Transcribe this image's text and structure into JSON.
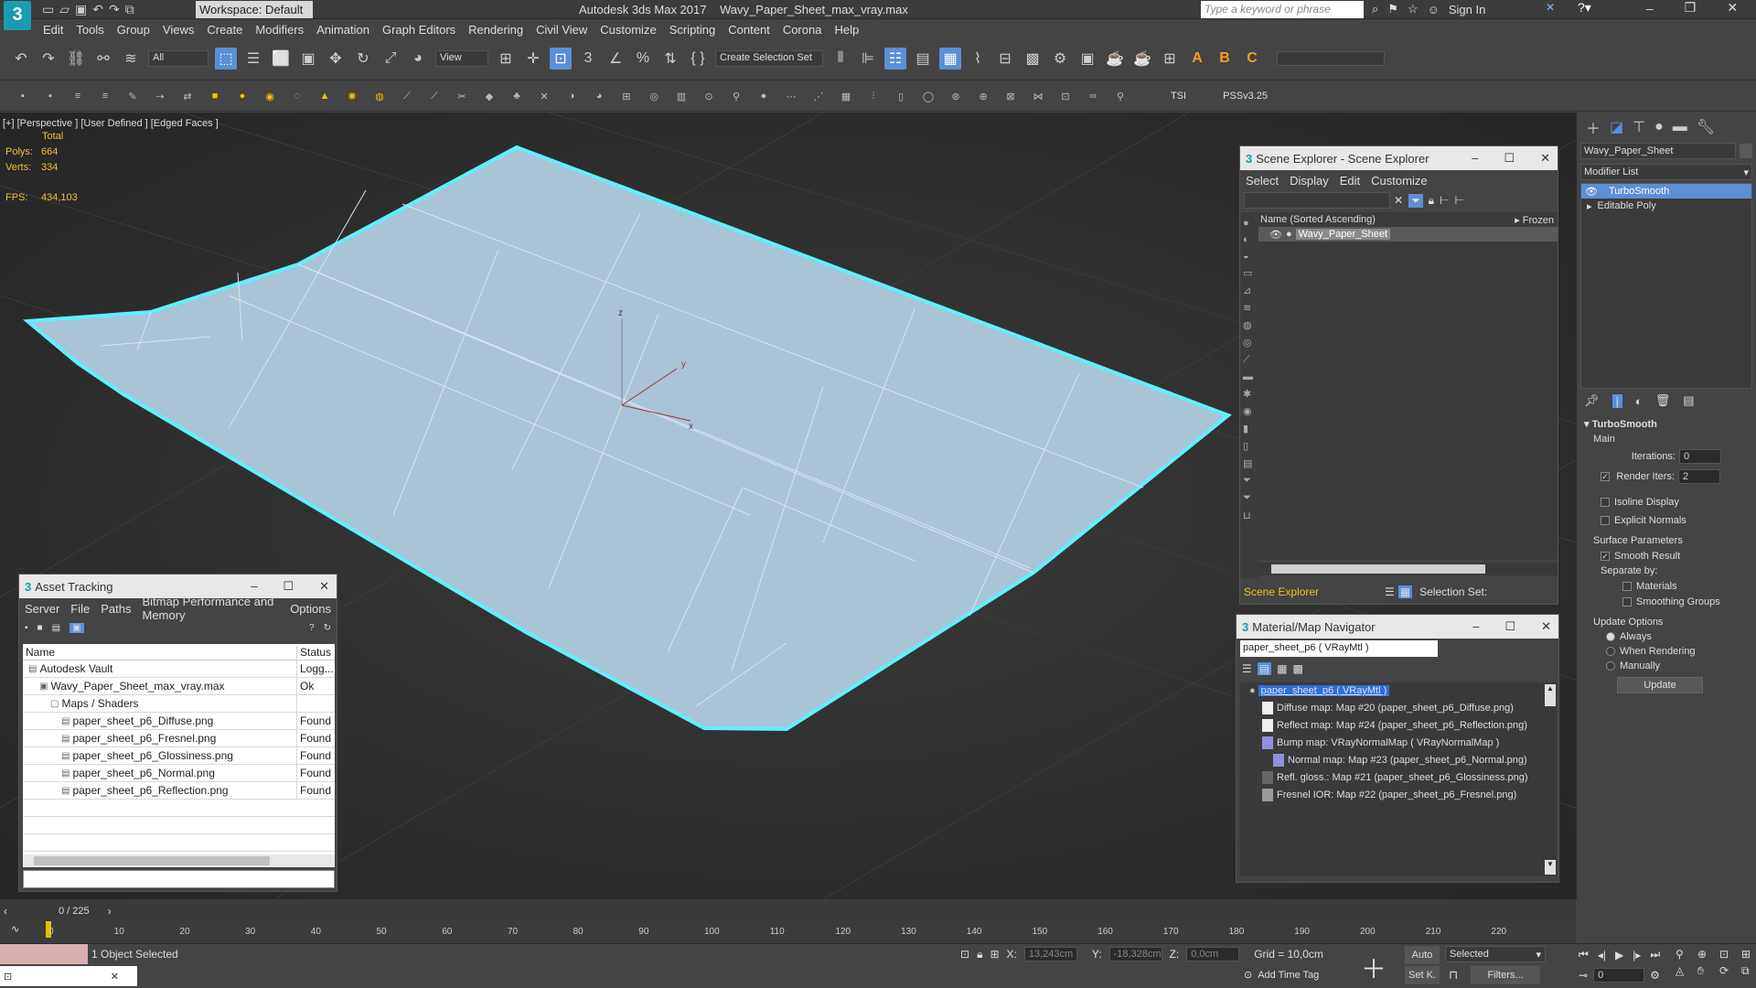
{
  "app": {
    "workspace": "Workspace: Default",
    "title": "Autodesk 3ds Max 2017",
    "file": "Wavy_Paper_Sheet_max_vray.max",
    "search_placeholder": "Type a keyword or phrase",
    "sign_in": "Sign In"
  },
  "menu": [
    "Edit",
    "Tools",
    "Group",
    "Views",
    "Create",
    "Modifiers",
    "Animation",
    "Graph Editors",
    "Rendering",
    "Civil View",
    "Customize",
    "Scripting",
    "Content",
    "Corona",
    "Help"
  ],
  "toolbar": {
    "filter": "All",
    "ref_coord": "View",
    "selection_set": "Create Selection Set",
    "tsi": "TSI",
    "pss": "PSSv3.25"
  },
  "viewport": {
    "label_plus": "[+]",
    "label_view": "[Perspective ]",
    "label_shading": "[User Defined ]",
    "label_edges": "[Edged Faces ]",
    "stats_total": "Total",
    "polys_label": "Polys:",
    "polys": "664",
    "verts_label": "Verts:",
    "verts": "334",
    "fps_label": "FPS:",
    "fps": "434,103",
    "axis_x": "x",
    "axis_y": "y",
    "axis_z": "z"
  },
  "scene_explorer": {
    "title": "Scene Explorer - Scene Explorer",
    "menu": [
      "Select",
      "Display",
      "Edit",
      "Customize"
    ],
    "col_name": "Name (Sorted Ascending)",
    "col_frozen": "▸ Frozen",
    "object": "Wavy_Paper_Sheet",
    "footer_name": "Scene Explorer",
    "selection_set": "Selection Set:"
  },
  "asset_tracking": {
    "title": "Asset Tracking",
    "menu": [
      "Server",
      "File",
      "Paths",
      "Bitmap Performance and Memory",
      "Options"
    ],
    "col_name": "Name",
    "col_status": "Status",
    "rows": [
      {
        "name": "Autodesk Vault",
        "status": "Logg...",
        "indent": 0
      },
      {
        "name": "Wavy_Paper_Sheet_max_vray.max",
        "status": "Ok",
        "indent": 1
      },
      {
        "name": "Maps / Shaders",
        "status": "",
        "indent": 2
      },
      {
        "name": "paper_sheet_p6_Diffuse.png",
        "status": "Found",
        "indent": 3
      },
      {
        "name": "paper_sheet_p6_Fresnel.png",
        "status": "Found",
        "indent": 3
      },
      {
        "name": "paper_sheet_p6_Glossiness.png",
        "status": "Found",
        "indent": 3
      },
      {
        "name": "paper_sheet_p6_Normal.png",
        "status": "Found",
        "indent": 3
      },
      {
        "name": "paper_sheet_p6_Reflection.png",
        "status": "Found",
        "indent": 3
      }
    ]
  },
  "material_nav": {
    "title": "Material/Map Navigator",
    "current": "paper_sheet_p6  ( VRayMtl )",
    "root": "paper_sheet_p6  ( VRayMtl )",
    "items": [
      "Diffuse map: Map #20 (paper_sheet_p6_Diffuse.png)",
      "Reflect map: Map #24 (paper_sheet_p6_Reflection.png)",
      "Bump map: VRayNormalMap  ( VRayNormalMap )",
      "Normal map: Map #23 (paper_sheet_p6_Normal.png)",
      "Refl. gloss.: Map #21 (paper_sheet_p6_Glossiness.png)",
      "Fresnel IOR: Map #22 (paper_sheet_p6_Fresnel.png)"
    ]
  },
  "command_panel": {
    "object_name": "Wavy_Paper_Sheet",
    "modifier_list": "Modifier List",
    "stack": [
      "TurboSmooth",
      "Editable Poly"
    ],
    "rollout": "TurboSmooth",
    "main": "Main",
    "iterations_label": "Iterations:",
    "iterations": "0",
    "render_iters_label": "Render Iters:",
    "render_iters": "2",
    "isoline": "Isoline Display",
    "explicit_normals": "Explicit Normals",
    "surface_params": "Surface Parameters",
    "smooth_result": "Smooth Result",
    "separate_by": "Separate by:",
    "materials": "Materials",
    "smoothing_groups": "Smoothing Groups",
    "update_options": "Update Options",
    "always": "Always",
    "when_rendering": "When Rendering",
    "manually": "Manually",
    "update_btn": "Update"
  },
  "timeline": {
    "frame": "0 / 225",
    "ticks": [
      "0",
      "10",
      "20",
      "30",
      "40",
      "50",
      "60",
      "70",
      "80",
      "90",
      "100",
      "110",
      "120",
      "130",
      "140",
      "150",
      "160",
      "170",
      "180",
      "190",
      "200",
      "210",
      "220"
    ]
  },
  "status": {
    "selected": "1 Object Selected",
    "x_label": "X:",
    "x": "13,243cm",
    "y_label": "Y:",
    "y": "-18,328cm",
    "z_label": "Z:",
    "z": "0,0cm",
    "grid": "Grid = 10,0cm",
    "add_time_tag": "Add Time Tag",
    "auto": "Auto",
    "set_key": "Set K.",
    "key_mode": "Selected",
    "filters": "Filters...",
    "frame_input": "0"
  }
}
